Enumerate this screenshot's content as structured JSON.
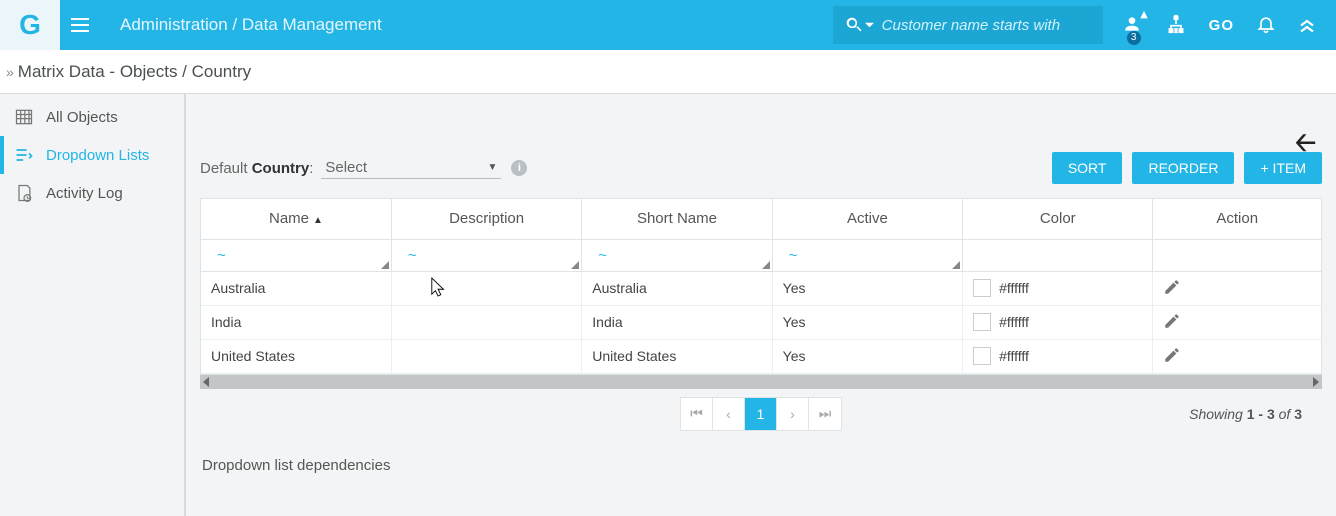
{
  "topbar": {
    "logo_char": "G",
    "breadcrumb": "Administration / Data Management",
    "search_placeholder": "Customer name starts with",
    "badge_count": "3",
    "go_label": "GO"
  },
  "subheader": {
    "title": "Matrix Data - Objects / Country"
  },
  "sidebar": {
    "items": [
      {
        "label": "All Objects"
      },
      {
        "label": "Dropdown Lists"
      },
      {
        "label": "Activity Log"
      }
    ]
  },
  "toolbar": {
    "default_prefix": "Default ",
    "default_bold": "Country",
    "default_suffix": ":",
    "select_placeholder": "Select",
    "sort_label": "SORT",
    "reorder_label": "REORDER",
    "additem_label": "+ ITEM"
  },
  "table": {
    "columns": [
      "Name",
      "Description",
      "Short Name",
      "Active",
      "Color",
      "Action"
    ],
    "rows": [
      {
        "name": "Australia",
        "description": "",
        "short_name": "Australia",
        "active": "Yes",
        "color": "#ffffff"
      },
      {
        "name": "India",
        "description": "",
        "short_name": "India",
        "active": "Yes",
        "color": "#ffffff"
      },
      {
        "name": "United States",
        "description": "",
        "short_name": "United States",
        "active": "Yes",
        "color": "#ffffff"
      }
    ]
  },
  "pagination": {
    "current": "1",
    "showing_prefix": "Showing ",
    "showing_range": "1 - 3",
    "showing_mid": " of ",
    "showing_total": "3"
  },
  "footer": {
    "deps_label": "Dropdown list dependencies"
  }
}
